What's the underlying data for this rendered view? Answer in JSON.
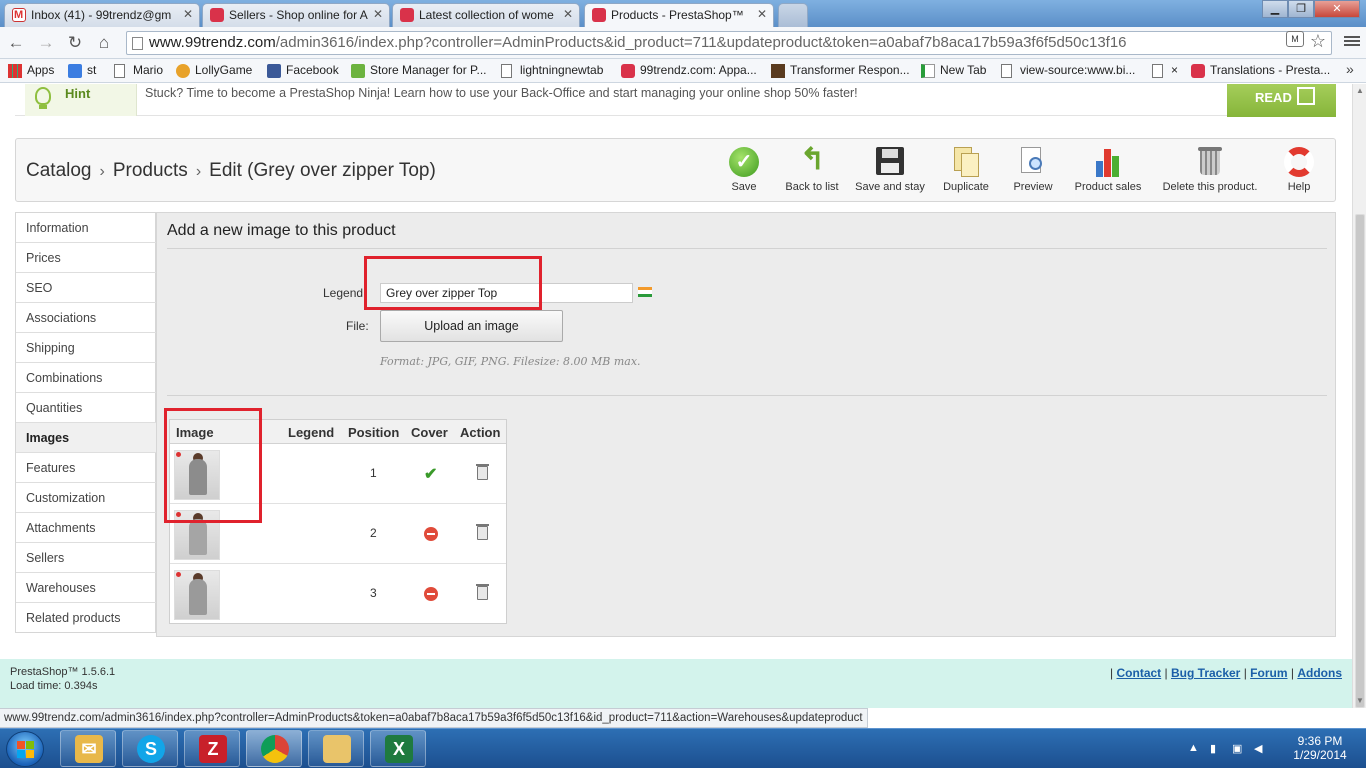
{
  "browser": {
    "tabs": [
      {
        "title": "Inbox (41) - 99trendz@gm",
        "icon": "gmail-icon"
      },
      {
        "title": "Sellers - Shop online for A",
        "icon": "99trendz-icon"
      },
      {
        "title": "Latest collection of wome",
        "icon": "99trendz-icon"
      },
      {
        "title": "Products - PrestaShop™",
        "icon": "99trendz-icon"
      }
    ],
    "url_domain": "www.99trendz.com",
    "url_path": "/admin3616/index.php?controller=AdminProducts&id_product=711&updateproduct&token=a0abaf7b8aca17b59a3f6f5d50c13f16",
    "bookmarks": [
      "Apps",
      "st",
      "Mario",
      "LollyGame",
      "Facebook",
      "Store Manager for P...",
      "lightningnewtab",
      "99trendz.com: Appa...",
      "Transformer Respon...",
      "New Tab",
      "view-source:www.bi...",
      "×",
      "Translations - Presta..."
    ],
    "status_url": "www.99trendz.com/admin3616/index.php?controller=AdminProducts&token=a0abaf7b8aca17b59a3f6f5d50c13f16&id_product=711&action=Warehouses&updateproduct"
  },
  "hint": {
    "label": "Hint",
    "text": "Stuck? Time to become a PrestaShop Ninja! Learn how to use your Back-Office and start managing your online shop 50% faster!",
    "read": "READ"
  },
  "breadcrumb": {
    "catalog": "Catalog",
    "products": "Products",
    "current": "Edit (Grey over zipper Top)",
    "sep": "›"
  },
  "toolbar": {
    "save": "Save",
    "back": "Back to list",
    "save_stay": "Save and stay",
    "duplicate": "Duplicate",
    "preview": "Preview",
    "product_sales": "Product sales",
    "delete": "Delete this product.",
    "help": "Help"
  },
  "sidebar": {
    "items": [
      "Information",
      "Prices",
      "SEO",
      "Associations",
      "Shipping",
      "Combinations",
      "Quantities",
      "Images",
      "Features",
      "Customization",
      "Attachments",
      "Sellers",
      "Warehouses",
      "Related products"
    ],
    "active": "Images"
  },
  "images_tab": {
    "title": "Add a new image to this product",
    "legend_label": "Legend",
    "legend_value": "Grey over zipper Top",
    "file_label": "File:",
    "upload_button": "Upload an image",
    "format_hint": "Format: JPG, GIF, PNG. Filesize: 8.00 MB max.",
    "table": {
      "headers": {
        "image": "Image",
        "legend": "Legend",
        "position": "Position",
        "cover": "Cover",
        "action": "Action"
      },
      "rows": [
        {
          "position": "1",
          "cover": true
        },
        {
          "position": "2",
          "cover": false
        },
        {
          "position": "3",
          "cover": false
        }
      ]
    }
  },
  "footer": {
    "version": "PrestaShop™ 1.5.6.1",
    "load_time": "Load time: 0.394s",
    "sep": "|",
    "links": [
      "Contact",
      "Bug Tracker",
      "Forum",
      "Addons"
    ]
  },
  "taskbar": {
    "time": "9:36 PM",
    "date": "1/29/2014"
  },
  "colors": {
    "accent_green": "#86b53a",
    "highlight_red": "#e0222d",
    "footer_bg": "#d3f3ec",
    "link_blue": "#1b5fa8"
  }
}
